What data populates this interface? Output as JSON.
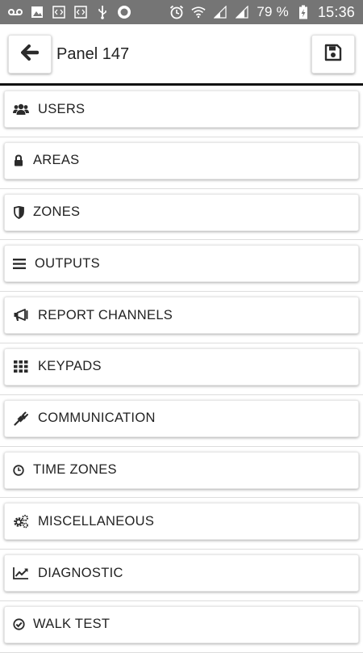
{
  "status_bar": {
    "battery_percent": "79 %",
    "time": "15:36",
    "icons_left": [
      "voicemail-icon",
      "image-icon",
      "code-icon",
      "code-icon",
      "usb-icon",
      "record-icon"
    ],
    "icons_right": [
      "alarm-icon",
      "wifi-icon",
      "signal-icon",
      "signal-icon",
      "battery-charging-icon"
    ]
  },
  "header": {
    "title": "Panel 147",
    "back_icon": "arrow-left-icon",
    "save_icon": "floppy-disk-icon"
  },
  "menu": {
    "items": [
      {
        "label": "USERS",
        "icon": "users-icon"
      },
      {
        "label": "AREAS",
        "icon": "lock-icon"
      },
      {
        "label": "ZONES",
        "icon": "shield-icon"
      },
      {
        "label": "OUTPUTS",
        "icon": "bars-icon"
      },
      {
        "label": "REPORT CHANNELS",
        "icon": "megaphone-icon"
      },
      {
        "label": "KEYPADS",
        "icon": "keypad-grid-icon"
      },
      {
        "label": "COMMUNICATION",
        "icon": "plug-icon"
      },
      {
        "label": "TIME ZONES",
        "icon": "clock-icon"
      },
      {
        "label": "MISCELLANEOUS",
        "icon": "gears-icon"
      },
      {
        "label": "DIAGNOSTIC",
        "icon": "line-chart-icon"
      },
      {
        "label": "WALK TEST",
        "icon": "check-circle-icon"
      }
    ]
  },
  "colors": {
    "status_bar_bg": "#757575",
    "header_rule": "#111111",
    "text": "#222222",
    "icon": "#2b2b2b"
  }
}
